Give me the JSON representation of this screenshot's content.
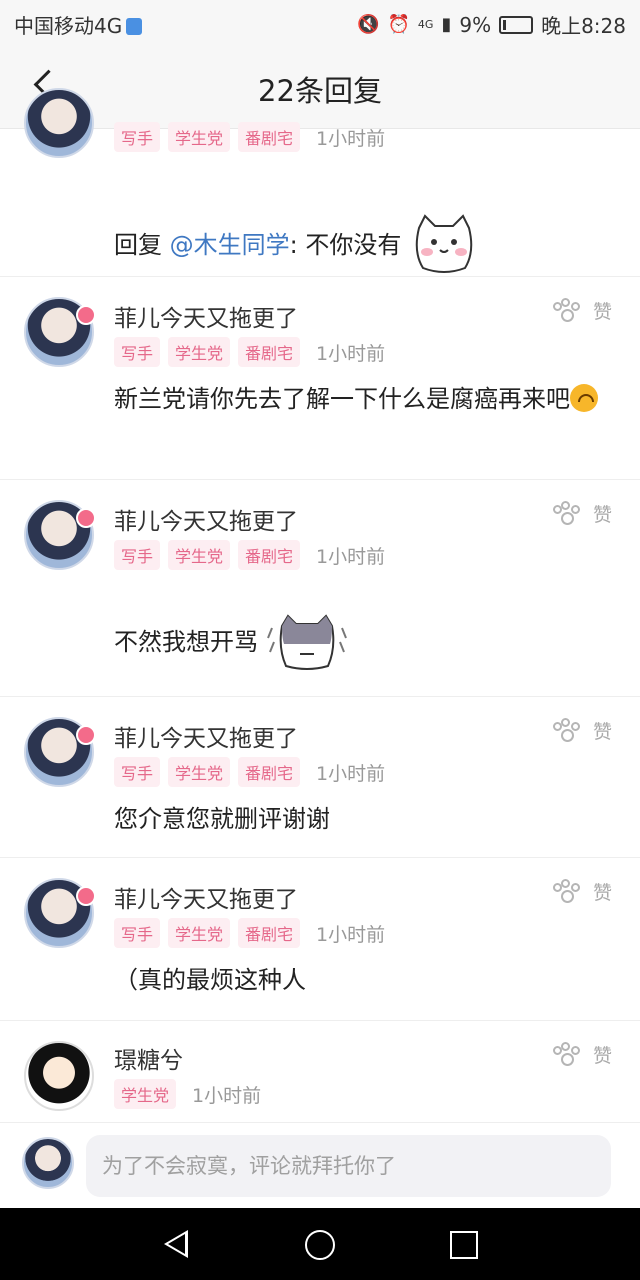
{
  "status_bar": {
    "carrier": "中国移动4G",
    "signal": "4G",
    "battery": "9%",
    "time": "晚上8:28"
  },
  "header": {
    "title": "22条回复"
  },
  "comments": [
    {
      "tags": [
        "写手",
        "学生党",
        "番剧宅"
      ],
      "time": "1小时前",
      "text_prefix": "回复 ",
      "mention": "@木生同学",
      "text": ": 不你没有",
      "sticker": "white-cat-sticker"
    },
    {
      "author": "菲儿今天又拖更了",
      "tags": [
        "写手",
        "学生党",
        "番剧宅"
      ],
      "time": "1小时前",
      "like_label": "赞",
      "text": "新兰党请你先去了解一下什么是腐癌再来吧",
      "emoji": "upside-down-face"
    },
    {
      "author": "菲儿今天又拖更了",
      "tags": [
        "写手",
        "学生党",
        "番剧宅"
      ],
      "time": "1小时前",
      "like_label": "赞",
      "text": "不然我想开骂",
      "sticker": "shaking-cat-sticker"
    },
    {
      "author": "菲儿今天又拖更了",
      "tags": [
        "写手",
        "学生党",
        "番剧宅"
      ],
      "time": "1小时前",
      "like_label": "赞",
      "text": "您介意您就删评谢谢"
    },
    {
      "author": "菲儿今天又拖更了",
      "tags": [
        "写手",
        "学生党",
        "番剧宅"
      ],
      "time": "1小时前",
      "like_label": "赞",
      "text": "（真的最烦这种人"
    },
    {
      "author": "璟糖兮",
      "tags": [
        "学生党"
      ],
      "time": "1小时前",
      "like_label": "赞"
    }
  ],
  "reply_box": {
    "placeholder": "为了不会寂寞，评论就拜托你了"
  },
  "colors": {
    "tag_bg": "#fdeef2",
    "tag_text": "#e5688a",
    "mention": "#3f78c2"
  }
}
